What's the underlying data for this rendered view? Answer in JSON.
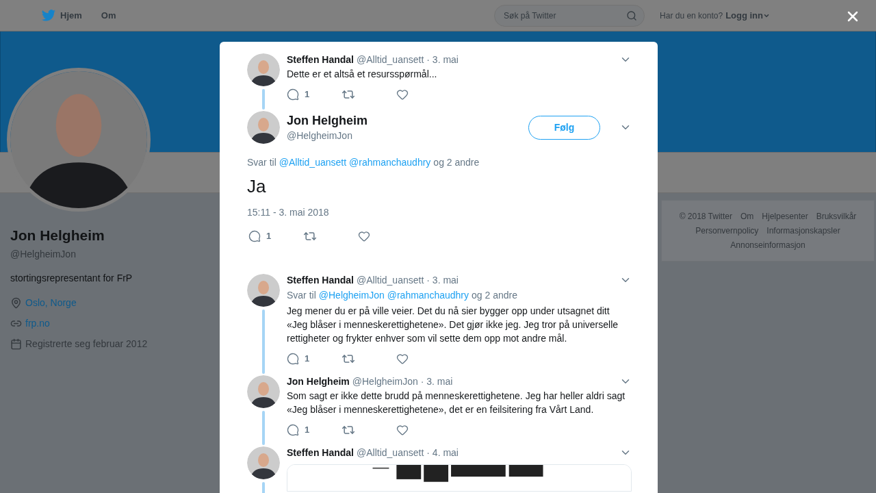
{
  "topbar": {
    "nav": [
      {
        "label": "Hjem"
      },
      {
        "label": "Om"
      }
    ],
    "search": {
      "placeholder": "Søk på Twitter"
    },
    "login_prompt": "Har du en konto?",
    "login": "Logg inn"
  },
  "profile": {
    "name": "Jon Helgheim",
    "handle": "@HelgheimJon",
    "bio": "stortingsrepresentant for FrP",
    "details": [
      {
        "kind": "location",
        "text": "Oslo, Norge"
      },
      {
        "kind": "url",
        "text": "frp.no"
      },
      {
        "kind": "joined",
        "text": "Registrerte seg februar 2012"
      }
    ]
  },
  "footer": {
    "links": [
      "© 2018 Twitter",
      "Om",
      "Hjelpesenter",
      "Bruksvilkår",
      "Personvernpolicy",
      "Informasjonskapsler",
      "Annonseinformasjon"
    ]
  },
  "modal": {
    "tweets": [
      {
        "kind": "thread",
        "name": "Steffen Handal",
        "handle": "@Alltid_uansett",
        "date": "· 3. mai",
        "text": "Dette er et altså et resursspørmål...",
        "reply_count": "1"
      },
      {
        "kind": "focused",
        "name": "Jon Helgheim",
        "handle": "@HelgheimJon",
        "follow": "Følg",
        "reply_to": {
          "prefix": "Svar til",
          "mentions": [
            "@Alltid_uansett",
            "@rahmanchaudhry"
          ],
          "suffix": "og 2 andre"
        },
        "text": "Ja",
        "timestamp": "15:11 - 3. mai 2018",
        "reply_count": "1"
      },
      {
        "kind": "thread",
        "name": "Steffen Handal",
        "handle": "@Alltid_uansett",
        "date": "· 3. mai",
        "reply_to": {
          "prefix": "Svar til",
          "mentions": [
            "@HelgheimJon",
            "@rahmanchaudhry"
          ],
          "suffix": "og 2 andre"
        },
        "text": "Jeg mener du er på ville veier. Det du nå sier bygger opp under utsagnet ditt «Jeg blåser i menneskerettighetene». Det gjør ikke jeg. Jeg tror på universelle rettigheter og frykter enhver som vil sette dem opp mot andre mål.",
        "reply_count": "1"
      },
      {
        "kind": "thread",
        "name": "Jon Helgheim",
        "handle": "@HelgheimJon",
        "date": "· 3. mai",
        "text": "Som sagt er ikke dette brudd på menneskerettighetene. Jeg har heller aldri sagt «Jeg blåser i menneskerettighetene», det er en feilsitering fra Vårt Land.",
        "reply_count": "1"
      },
      {
        "kind": "thread",
        "name": "Steffen Handal",
        "handle": "@Alltid_uansett",
        "date": "· 4. mai"
      }
    ]
  }
}
